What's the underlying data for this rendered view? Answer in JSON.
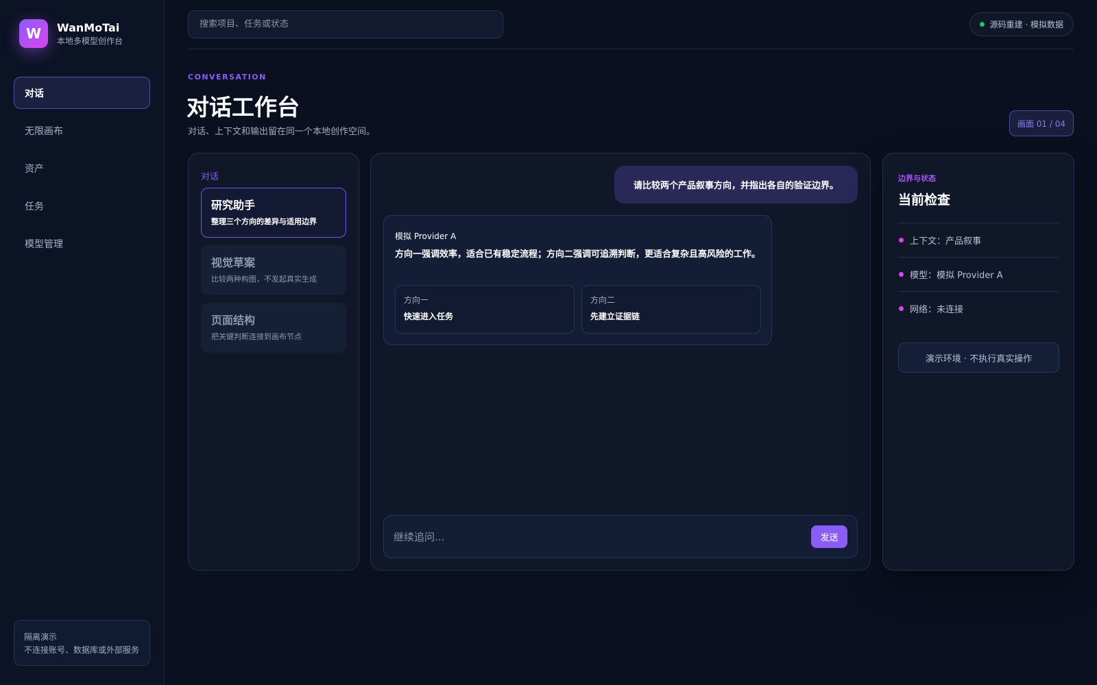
{
  "brand": {
    "logo_letter": "W",
    "name": "WanMoTai",
    "subtitle": "本地多模型创作台",
    "logo_gradient": [
      "#8b5cf6",
      "#d946ef"
    ]
  },
  "sidebar": {
    "items": [
      {
        "label": "对话",
        "active": true
      },
      {
        "label": "无限画布",
        "active": false
      },
      {
        "label": "资产",
        "active": false
      },
      {
        "label": "任务",
        "active": false
      },
      {
        "label": "模型管理",
        "active": false
      }
    ],
    "note": {
      "title": "隔离演示",
      "body": "不连接账号、数据库或外部服务"
    }
  },
  "topbar": {
    "search_placeholder": "搜索项目、任务或状态",
    "status_text": "源码重建 · 模拟数据",
    "status_color": "#22c55e"
  },
  "header": {
    "eyebrow": "CONVERSATION",
    "title": "对话工作台",
    "subtitle": "对话、上下文和输出留在同一个本地创作空间。",
    "screen_badge": "画面 01 / 04"
  },
  "conversations": {
    "label": "对话",
    "items": [
      {
        "title": "研究助手",
        "desc": "整理三个方向的差异与适用边界",
        "active": true
      },
      {
        "title": "视觉草案",
        "desc": "比较两种构图，不发起真实生成",
        "active": false
      },
      {
        "title": "页面结构",
        "desc": "把关键判断连接到画布节点",
        "active": false
      }
    ]
  },
  "chat": {
    "user_message": "请比较两个产品叙事方向，并指出各自的验证边界。",
    "reply": {
      "provider": "模拟 Provider A",
      "text": "方向一强调效率，适合已有稳定流程；方向二强调可追溯判断，更适合复杂且高风险的工作。",
      "directions": [
        {
          "label": "方向一",
          "value": "快速进入任务"
        },
        {
          "label": "方向二",
          "value": "先建立证据链"
        }
      ]
    },
    "composer_placeholder": "继续追问...",
    "send_label": "发送"
  },
  "inspector": {
    "eyebrow": "边界与状态",
    "title": "当前检查",
    "items": [
      {
        "text": "上下文：产品叙事"
      },
      {
        "text": "模型：模拟 Provider A"
      },
      {
        "text": "网络：未连接"
      }
    ],
    "env_note": "演示环境 · 不执行真实操作"
  },
  "colors": {
    "accent": "#8b5cf6",
    "accent_pink": "#d946ef",
    "background": "#0a1020",
    "panel": "#0f1729"
  }
}
